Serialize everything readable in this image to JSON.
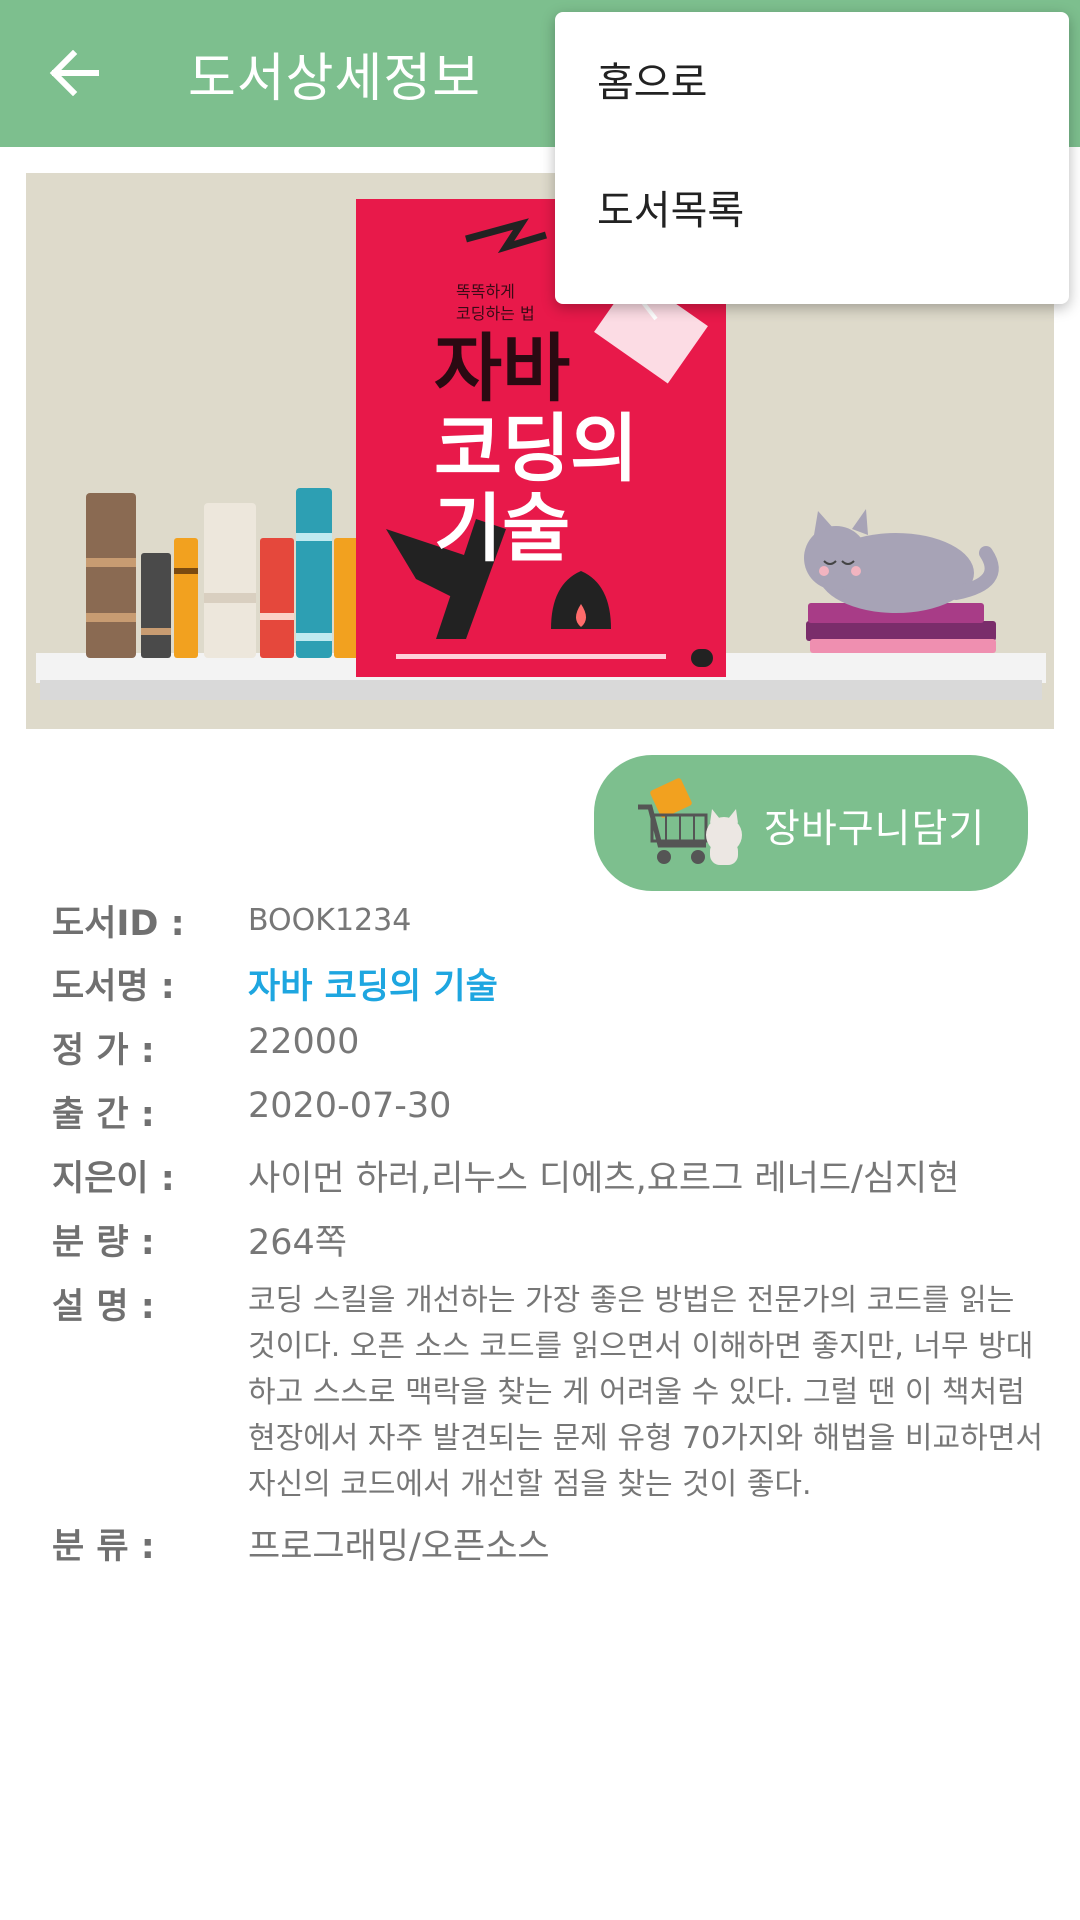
{
  "appbar": {
    "title": "도서상세정보"
  },
  "cover": {
    "tagline_1": "똑똑하게",
    "tagline_2": "코딩하는 법",
    "title_line_1": "자바",
    "title_line_2": "코딩의",
    "title_line_3": "기술",
    "accent_color": "#e8194a"
  },
  "cart_button": {
    "label": "장바구니담기"
  },
  "details": [
    {
      "label": "도서ID :",
      "value": "BOOK1234"
    },
    {
      "label": "도서명 :",
      "value": "자바 코딩의 기술"
    },
    {
      "label": "정 가 :",
      "value": "22000"
    },
    {
      "label": "출 간 :",
      "value": "2020-07-30"
    },
    {
      "label": "지은이 :",
      "value": "사이먼 하러,리누스 디에츠,요르그 레너드/심지현"
    },
    {
      "label": "분 량 :",
      "value": "264쪽"
    },
    {
      "label": "설 명 :",
      "value": "코딩 스킬을 개선하는 가장 좋은 방법은 전문가의 코드를 읽는 것이다. 오픈 소스 코드를 읽으면서 이해하면 좋지만, 너무 방대하고 스스로 맥락을 찾는 게 어려울 수 있다. 그럴 땐 이 책처럼 현장에서 자주 발견되는 문제 유형 70가지와 해법을 비교하면서 자신의 코드에서 개선할 점을 찾는 것이 좋다."
    },
    {
      "label": "분 류 :",
      "value": "프로그래밍/오픈소스"
    }
  ],
  "menu": {
    "items": [
      {
        "label": "홈으로"
      },
      {
        "label": "도서목록"
      }
    ]
  },
  "colors": {
    "appbar": "#7dbf8e",
    "title_link": "#1ea6e0"
  },
  "icons": [
    "back-arrow-icon",
    "cart-icon"
  ]
}
